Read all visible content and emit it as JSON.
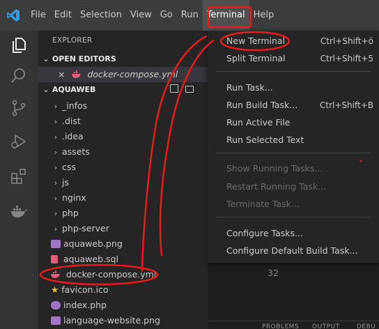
{
  "menubar": {
    "items": [
      "File",
      "Edit",
      "Selection",
      "View",
      "Go",
      "Run",
      "Terminal",
      "Help"
    ]
  },
  "explorer": {
    "title": "EXPLORER",
    "open_editors_label": "OPEN EDITORS",
    "open_editor_file": "docker-compose.yml",
    "workspace_label": "AQUAWEB",
    "folders": [
      "_infos",
      ".dist",
      ".idea",
      "assets",
      "css",
      "js",
      "nginx",
      "php",
      "php-server"
    ],
    "files": [
      "aquaweb.png",
      "aquaweb.sql",
      "docker-compose.yml",
      "favicon.ico",
      "index.php",
      "language-website.png"
    ]
  },
  "terminal_menu": {
    "items": [
      {
        "label": "New Terminal",
        "shortcut": "Ctrl+Shift+ö"
      },
      {
        "label": "Split Terminal",
        "shortcut": "Ctrl+Shift+5"
      },
      {
        "label": "Run Task...",
        "shortcut": ""
      },
      {
        "label": "Run Build Task...",
        "shortcut": "Ctrl+Shift+B"
      },
      {
        "label": "Run Active File",
        "shortcut": ""
      },
      {
        "label": "Run Selected Text",
        "shortcut": ""
      },
      {
        "label": "Show Running Tasks...",
        "shortcut": ""
      },
      {
        "label": "Restart Running Task...",
        "shortcut": ""
      },
      {
        "label": "Terminate Task...",
        "shortcut": ""
      },
      {
        "label": "Configure Tasks...",
        "shortcut": ""
      },
      {
        "label": "Configure Default Build Task...",
        "shortcut": ""
      }
    ]
  },
  "editor": {
    "line_number": "32"
  },
  "panel": {
    "tabs": [
      "PROBLEMS",
      "OUTPUT",
      "DEBU"
    ]
  },
  "colors": {
    "annotation": "#e81c1c",
    "docker_blue": "#1d91e6",
    "yaml_pink": "#e85a7a"
  }
}
